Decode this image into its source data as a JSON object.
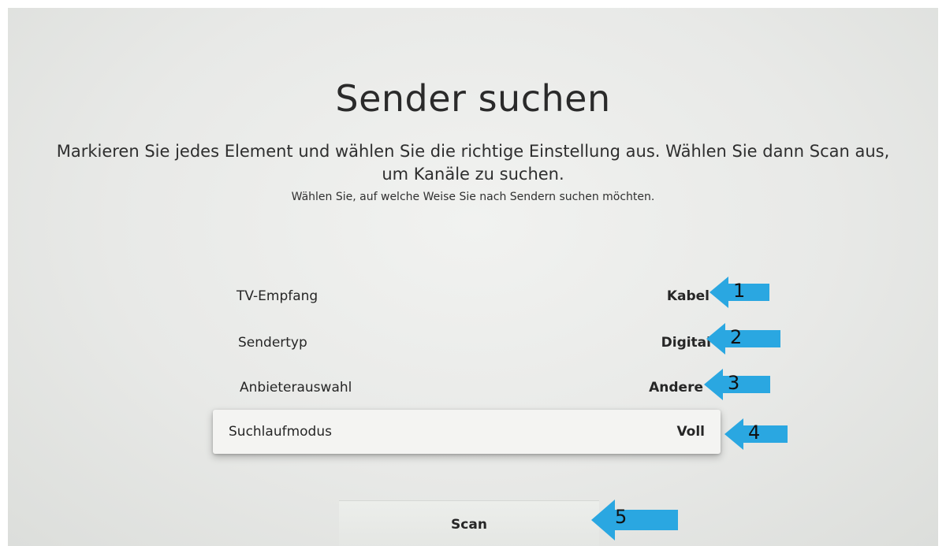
{
  "page": {
    "title": "Sender suchen",
    "description": "Markieren Sie jedes Element und wählen Sie die richtige Einstellung aus. Wählen Sie dann Scan aus, um Kanäle zu suchen.",
    "hint": "Wählen Sie, auf welche Weise Sie nach Sendern suchen möchten."
  },
  "settings": [
    {
      "label": "TV-Empfang",
      "value": "Kabel"
    },
    {
      "label": "Sendertyp",
      "value": "Digital"
    },
    {
      "label": "Anbieterauswahl",
      "value": "Andere"
    },
    {
      "label": "Suchlaufmodus",
      "value": "Voll"
    }
  ],
  "scan_label": "Scan",
  "annotations": {
    "arrow_color": "#2aa7e1",
    "numbers": [
      "1",
      "2",
      "3",
      "4",
      "5"
    ]
  }
}
